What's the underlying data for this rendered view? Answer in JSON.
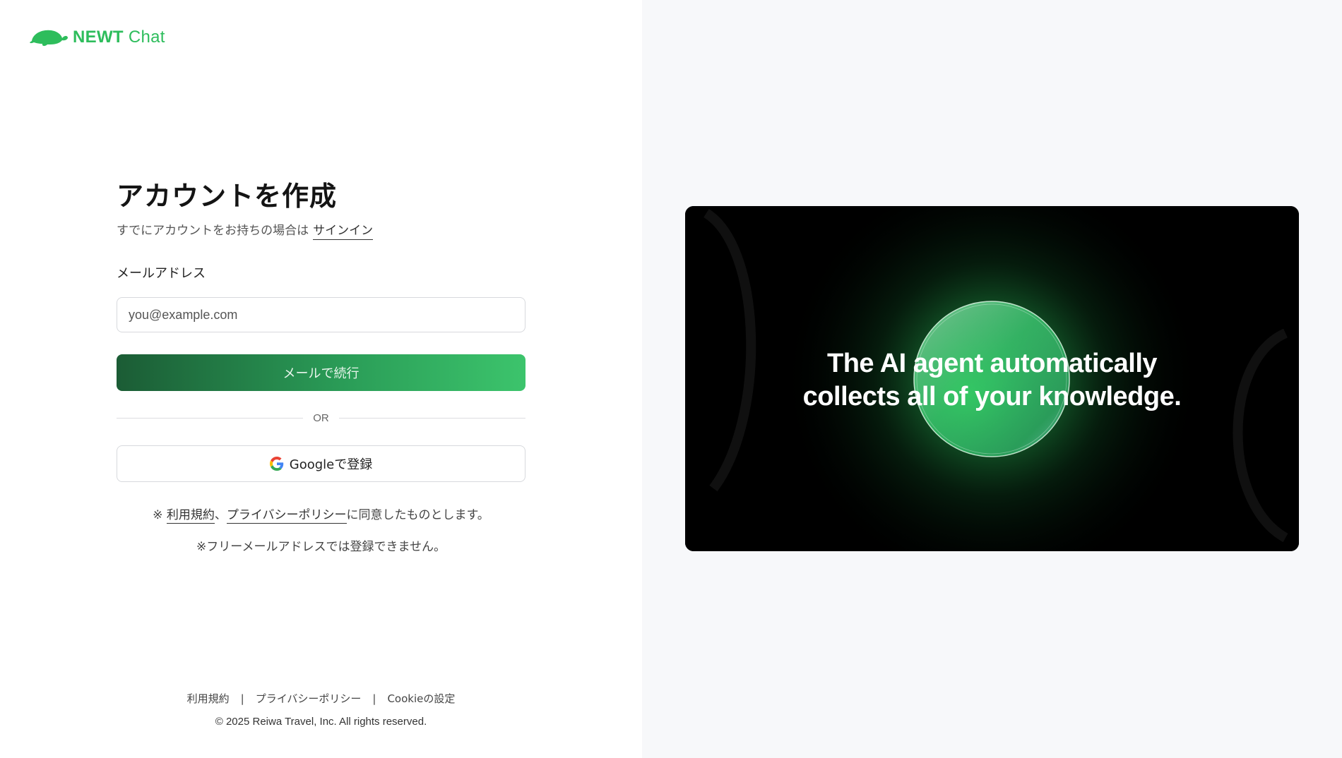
{
  "brand": {
    "name_bold": "NEWT",
    "name_light": "Chat",
    "color": "#2ebd5c",
    "icon": "turtle-logo-icon"
  },
  "form": {
    "title": "アカウントを作成",
    "subtitle": "すでにアカウントをお持ちの場合は",
    "signin_link": "サインイン",
    "email_label": "メールアドレス",
    "email_placeholder": "you@example.com",
    "email_value": "",
    "continue_button": "メールで続行",
    "divider": "OR",
    "google_button": "Googleで登録",
    "terms_prefix": "※ ",
    "terms_link": "利用規約",
    "terms_sep": "、",
    "privacy_link": "プライバシーポリシー",
    "terms_suffix": "に同意したものとします。",
    "free_mail_note": "※フリーメールアドレスでは登録できません。"
  },
  "footer": {
    "links": [
      "利用規約",
      "プライバシーポリシー",
      "Cookieの設定"
    ],
    "separator": "|",
    "copyright": "© 2025 Reiwa Travel, Inc. All rights reserved."
  },
  "hero": {
    "line1": "The AI agent automatically",
    "line2": "collects all of your knowledge."
  },
  "colors": {
    "accent_green": "#2ebd5c",
    "button_dark": "#1b5c35",
    "button_light": "#3cc46c",
    "panel_bg": "#f7f8fa"
  }
}
